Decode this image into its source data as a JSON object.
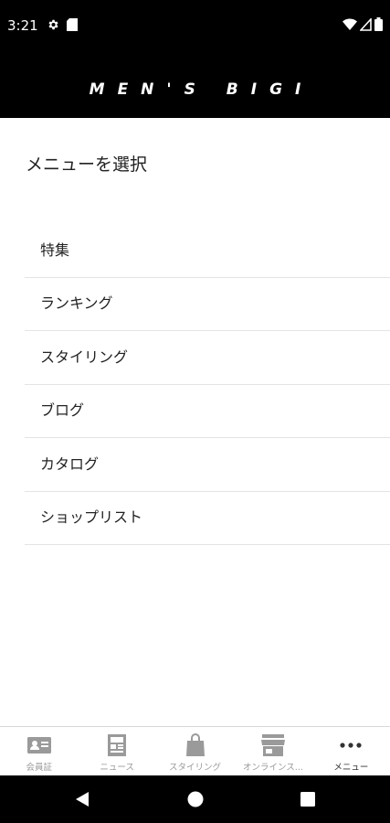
{
  "status_bar": {
    "time": "3:21",
    "left_icons": [
      "settings-icon",
      "sd-card-icon"
    ],
    "right_icons": [
      "wifi-icon",
      "cell-signal-icon",
      "battery-icon"
    ]
  },
  "header": {
    "brand": "MEN'S BIGI",
    "background": "#000000"
  },
  "menu": {
    "heading": "メニューを選択",
    "items": [
      {
        "label": "特集"
      },
      {
        "label": "ランキング"
      },
      {
        "label": "スタイリング"
      },
      {
        "label": "ブログ"
      },
      {
        "label": "カタログ"
      },
      {
        "label": "ショップリスト"
      }
    ]
  },
  "bottom_nav": {
    "items": [
      {
        "label": "会員証",
        "icon": "member-card-icon",
        "active": false
      },
      {
        "label": "ニュース",
        "icon": "news-icon",
        "active": false
      },
      {
        "label": "スタイリング",
        "icon": "shopping-bag-icon",
        "active": false
      },
      {
        "label": "オンラインス...",
        "icon": "store-icon",
        "active": false
      },
      {
        "label": "メニュー",
        "icon": "more-icon",
        "active": true
      }
    ]
  },
  "system_nav": [
    "back-icon",
    "home-icon",
    "recents-icon"
  ]
}
